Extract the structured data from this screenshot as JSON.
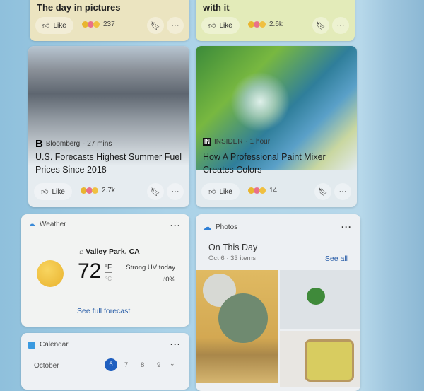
{
  "feed": [
    {
      "title": "The day in pictures",
      "like": "Like",
      "reactions": "237",
      "bg": "#ebe4c0"
    },
    {
      "title": "with it",
      "like": "Like",
      "reactions": "2.6k",
      "bg": "#e3ebb9"
    },
    {
      "source": "Bloomberg",
      "time": "· 27 mins",
      "logo": "B",
      "title": "U.S. Forecasts Highest Summer Fuel Prices Since 2018",
      "like": "Like",
      "reactions": "2.7k"
    },
    {
      "source": "INSIDER",
      "time": "· 1 hour",
      "logo": "IN",
      "title": "How A Professional Paint Mixer Creates Colors",
      "like": "Like",
      "reactions": "14"
    }
  ],
  "weather": {
    "label": "Weather",
    "location": "Valley Park, CA",
    "temp": "72",
    "unit_f": "°F",
    "unit_c": "°C",
    "condition": "Strong UV today",
    "precip": "0%",
    "link": "See full forecast",
    "more": "···"
  },
  "photos": {
    "label": "Photos",
    "heading": "On This Day",
    "date": "Oct 6",
    "count": "· 33 items",
    "see_all": "See all",
    "more": "···"
  },
  "calendar": {
    "label": "Calendar",
    "month": "October",
    "days": [
      "6",
      "7",
      "8",
      "9"
    ],
    "selected": "6",
    "more": "···",
    "accent": "#1f5fbf"
  }
}
